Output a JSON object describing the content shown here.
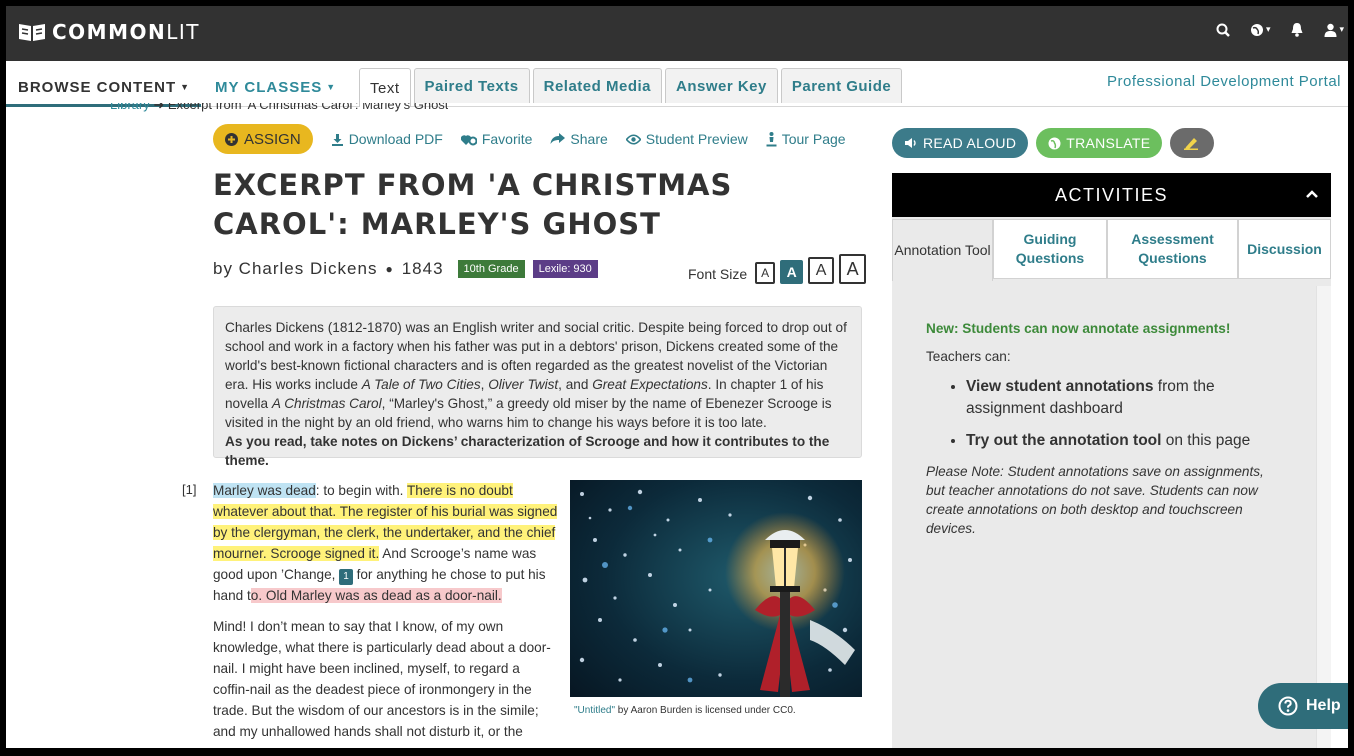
{
  "app": {
    "logo_bold": "COMMON",
    "logo_light": "LIT"
  },
  "nav": {
    "browse": "BROWSE CONTENT",
    "classes": "MY CLASSES",
    "tabs": [
      "Text",
      "Paired Texts",
      "Related Media",
      "Answer Key",
      "Parent Guide"
    ],
    "active_tab": "Text",
    "pd_portal": "Professional Development Portal"
  },
  "breadcrumb": {
    "library": "Library",
    "current": "Excerpt from 'A Christmas Carol': Marley's Ghost"
  },
  "actions": {
    "assign": "ASSIGN",
    "download": "Download PDF",
    "favorite": "Favorite",
    "share": "Share",
    "preview": "Student Preview",
    "tour": "Tour Page"
  },
  "text": {
    "title": "EXCERPT FROM 'A CHRISTMAS CAROL': MARLEY'S GHOST",
    "by": "by Charles Dickens",
    "year": "1843",
    "grade": "10th Grade",
    "lexile": "Lexile: 930",
    "font_size_label": "Font Size",
    "font_size_options": [
      "A",
      "A",
      "A",
      "A"
    ],
    "intro_1": "Charles Dickens (1812-1870) was an English writer and social critic. Despite being forced to drop out of school and work in a factory when his father was put in a debtors' prison, Dickens created some of the world's best-known fictional characters and is often regarded as the greatest novelist of the Victorian era. His works include ",
    "intro_work1": "A Tale of Two Cities",
    "intro_sep1": ", ",
    "intro_work2": "Oliver Twist",
    "intro_sep2": ", and ",
    "intro_work3": "Great Expectations",
    "intro_2": ". In chapter 1 of his novella ",
    "intro_work4": "A Christmas Carol",
    "intro_3": ", “Marley's Ghost,” a greedy old miser by the name of Ebenezer Scrooge is visited in the night by an old friend, who warns him to change his ways before it is too late.",
    "intro_bold": "As you read, take notes on Dickens’ characterization of Scrooge and how it contributes to the theme.",
    "para_num": "[1]",
    "p1_blue": "Marley was dead",
    "p1_a": ": to begin with. ",
    "p1_yellow": "There is no doubt whatever about that. The register of his burial was signed by the clergyman, the clerk, the undertaker, and the chief mourner. Scrooge signed it.",
    "p1_b": " And Scrooge’s name was good upon ’Change, ",
    "footnote": "1",
    "p1_c": " for anything he chose to put his hand t",
    "p1_pink": "o. Old Marley was as dead as a door-nail.",
    "p2": "Mind! I don’t mean to say that I know, of my own knowledge, what there is particularly dead about a door-nail. I might have been inclined, myself, to regard a coffin-nail as the deadest piece of ironmongery in the trade. But the wisdom of our ancestors is in the simile; and my unhallowed hands shall not disturb it, or the",
    "caption_link": "\"Untitled\"",
    "caption_rest": " by Aaron Burden is licensed under CC0."
  },
  "panel": {
    "read_aloud": "READ ALOUD",
    "translate": "TRANSLATE",
    "activities": "ACTIVITIES",
    "tabs": [
      "Annotation Tool",
      "Guiding Questions",
      "Assessment Questions",
      "Discussion"
    ],
    "new_note": "New: Students can now annotate assignments!",
    "teachers_can": "Teachers can:",
    "li1_bold": "View student annotations",
    "li1_rest": " from the assignment dashboard",
    "li2_bold": "Try out the annotation tool",
    "li2_rest": " on this page",
    "please_note": "Please Note: Student annotations save on assignments, but teacher annotations do not save. Students can now create annotations on both desktop and touchscreen devices."
  },
  "help": "Help",
  "colors": {
    "topbar": "#323232",
    "teal": "#2f6d7a",
    "assign": "#e8b71f",
    "translate": "#6cbf5e",
    "grade": "#3d7a3a",
    "lexile": "#5c3d87"
  }
}
